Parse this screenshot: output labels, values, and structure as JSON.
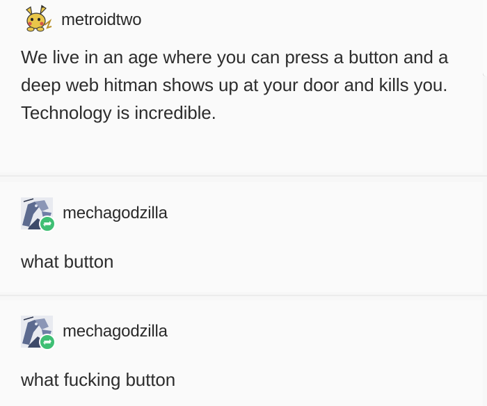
{
  "posts": [
    {
      "username": "metroidtwo",
      "avatar_icon": "pikachu-avatar-icon",
      "text": "We live in an age where you can press a button and a deep web hitman shows up at your door and kills you. Technology is incredible."
    },
    {
      "username": "mechagodzilla",
      "avatar_icon": "mechagodzilla-avatar-icon",
      "reblog_icon": "reblog-icon",
      "text": "what button"
    },
    {
      "username": "mechagodzilla",
      "avatar_icon": "mechagodzilla-avatar-icon",
      "reblog_icon": "reblog-icon",
      "text": "what fucking button"
    }
  ],
  "colors": {
    "reblog_badge": "#3fbf74",
    "avatar_yellow": "#e9c64a",
    "avatar_blue": "#5c6a8f"
  }
}
